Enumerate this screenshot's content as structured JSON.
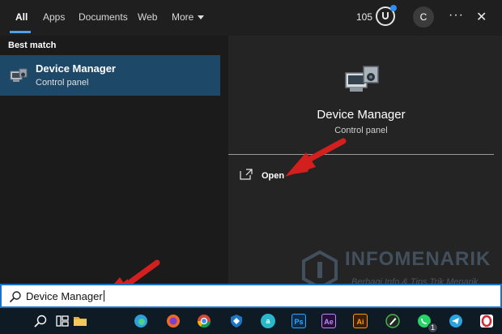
{
  "tabs": [
    {
      "label": "All",
      "active": true
    },
    {
      "label": "Apps"
    },
    {
      "label": "Documents"
    },
    {
      "label": "Web"
    },
    {
      "label": "More"
    }
  ],
  "header": {
    "points": "105",
    "avatar_initial": "C",
    "more_options": "···",
    "close": "✕"
  },
  "best_match": {
    "heading": "Best match",
    "result": {
      "title": "Device Manager",
      "subtitle": "Control panel",
      "icon": "device-manager-icon"
    }
  },
  "preview": {
    "title": "Device Manager",
    "subtitle": "Control panel",
    "actions": [
      {
        "label": "Open",
        "icon": "open-icon"
      }
    ]
  },
  "search": {
    "value": "Device Manager"
  },
  "watermark": {
    "title": "INFOMENARIK",
    "tagline": "Berbagi Info & Tips Trik Menarik"
  },
  "taskbar": {
    "items": [
      {
        "name": "search-icon"
      },
      {
        "name": "task-view-icon"
      },
      {
        "name": "file-explorer-icon",
        "color": "#e8b33a"
      },
      {
        "name": "edge-icon",
        "color": "#2f9fd8"
      },
      {
        "name": "firefox-icon",
        "color": "#f06a25"
      },
      {
        "name": "chrome-icon",
        "color": "#3fa14a"
      },
      {
        "name": "shield-app-icon",
        "color": "#1d77c3"
      },
      {
        "name": "amazon-icon",
        "color": "#29b7c9",
        "label": "a"
      },
      {
        "name": "photoshop-icon",
        "color": "#0b2b4a",
        "label": "Ps",
        "text_color": "#31a8ff"
      },
      {
        "name": "premiere-icon",
        "color": "#2a0e3a",
        "label": "Ae",
        "text_color": "#b48cff"
      },
      {
        "name": "illustrator-icon",
        "color": "#3a1e06",
        "label": "Ai",
        "text_color": "#ff9a00"
      },
      {
        "name": "pen-app-icon",
        "color": "#2e7d32"
      },
      {
        "name": "whatsapp-icon",
        "color": "#25d366",
        "badge": "1"
      },
      {
        "name": "telegram-icon",
        "color": "#2aa3df"
      },
      {
        "name": "opera-icon",
        "color": "#d8262e"
      }
    ]
  },
  "colors": {
    "accent": "#4ea1e8",
    "selected_row": "#1d4868",
    "annotation_arrow": "#d41f1f"
  }
}
